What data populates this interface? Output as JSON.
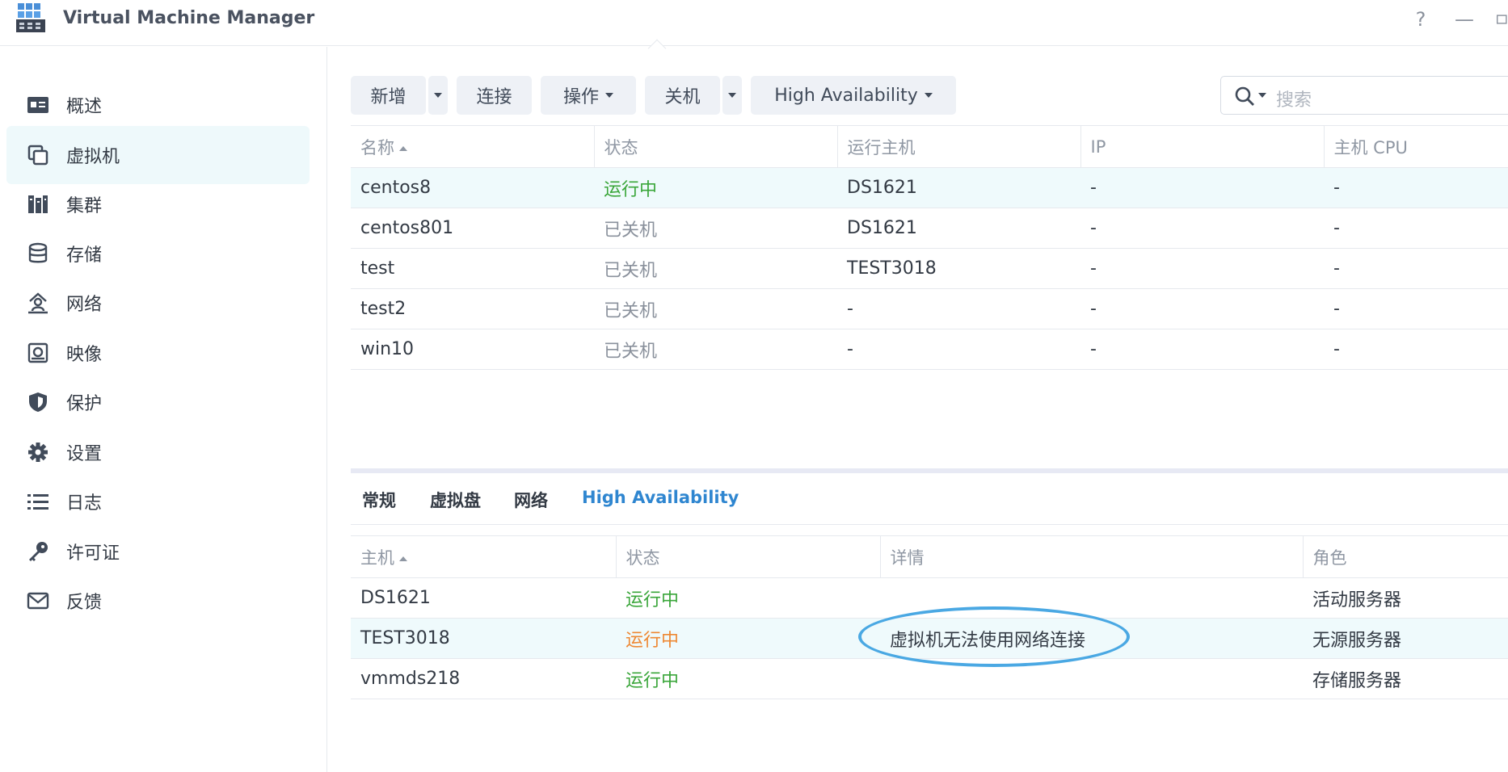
{
  "window": {
    "title": "Virtual Machine Manager",
    "help_label": "?",
    "minimize_label": "—"
  },
  "sidebar": {
    "items": [
      {
        "label": "概述",
        "icon": "overview-icon"
      },
      {
        "label": "虚拟机",
        "icon": "virtual-machine-icon",
        "active": true
      },
      {
        "label": "集群",
        "icon": "cluster-icon"
      },
      {
        "label": "存储",
        "icon": "storage-icon"
      },
      {
        "label": "网络",
        "icon": "network-icon"
      },
      {
        "label": "映像",
        "icon": "image-icon"
      },
      {
        "label": "保护",
        "icon": "shield-icon"
      },
      {
        "label": "设置",
        "icon": "gear-icon"
      },
      {
        "label": "日志",
        "icon": "list-icon"
      },
      {
        "label": "许可证",
        "icon": "key-icon"
      },
      {
        "label": "反馈",
        "icon": "mail-icon"
      }
    ]
  },
  "toolbar": {
    "add_label": "新增",
    "connect_label": "连接",
    "action_label": "操作",
    "shutdown_label": "关机",
    "ha_label": "High Availability",
    "search_placeholder": "搜索"
  },
  "vm_table": {
    "columns": [
      "名称",
      "状态",
      "运行主机",
      "IP",
      "主机 CPU"
    ],
    "rows": [
      {
        "name": "centos8",
        "status": "运行中",
        "host": "DS1621",
        "ip": "-",
        "cpu": "-"
      },
      {
        "name": "centos801",
        "status": "已关机",
        "host": "DS1621",
        "ip": "-",
        "cpu": "-"
      },
      {
        "name": "test",
        "status": "已关机",
        "host": "TEST3018",
        "ip": "-",
        "cpu": "-"
      },
      {
        "name": "test2",
        "status": "已关机",
        "host": "-",
        "ip": "-",
        "cpu": "-"
      },
      {
        "name": "win10",
        "status": "已关机",
        "host": "-",
        "ip": "-",
        "cpu": "-"
      }
    ]
  },
  "detail_tabs": [
    "常规",
    "虚拟盘",
    "网络",
    "High Availability"
  ],
  "ha_table": {
    "columns": [
      "主机",
      "状态",
      "详情",
      "角色"
    ],
    "rows": [
      {
        "host": "DS1621",
        "status": "运行中",
        "detail": "",
        "role": "活动服务器"
      },
      {
        "host": "TEST3018",
        "status": "运行中",
        "detail": "虚拟机无法使用网络连接",
        "role": "无源服务器"
      },
      {
        "host": "vmmds218",
        "status": "运行中",
        "detail": "",
        "role": "存储服务器"
      }
    ]
  },
  "colors": {
    "running_green": "#3aa63a",
    "warning_orange": "#ee8833",
    "accent_blue": "#2f86d0",
    "annotation_circle": "#4aa8e3"
  }
}
